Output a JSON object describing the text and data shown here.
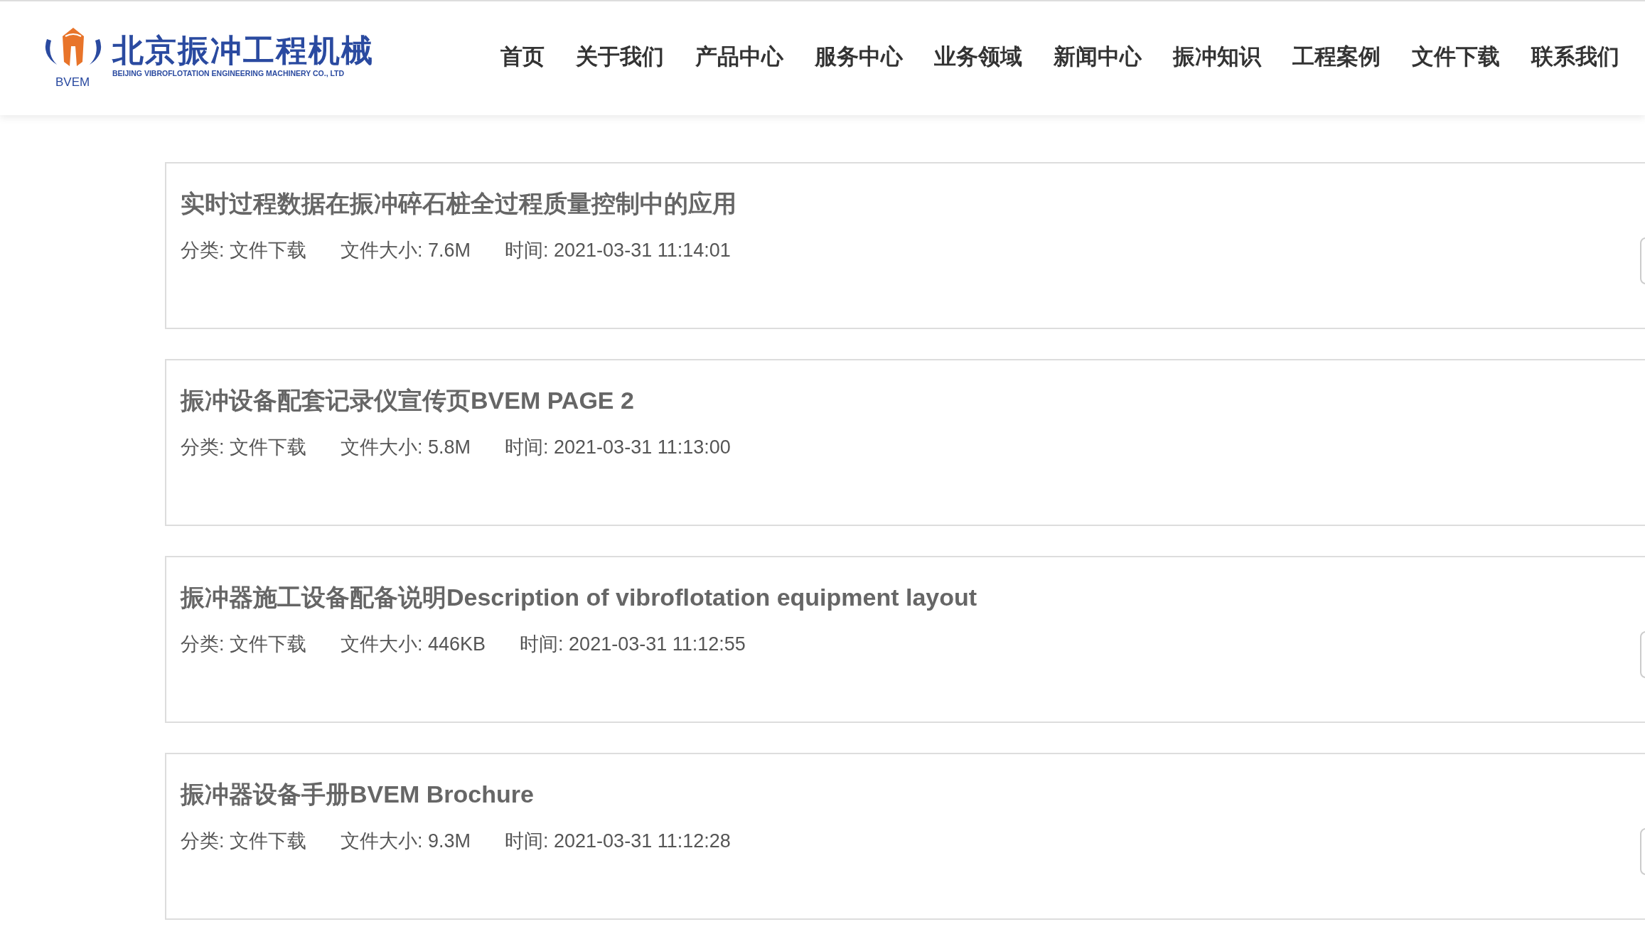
{
  "logo": {
    "badge": "BVEM",
    "name": "北京振冲工程机械",
    "english": "BEIJING VIBROFLOTATION ENGINEERING MACHINERY CO., LTD"
  },
  "nav": [
    {
      "label": "首页"
    },
    {
      "label": "关于我们"
    },
    {
      "label": "产品中心"
    },
    {
      "label": "服务中心"
    },
    {
      "label": "业务领域"
    },
    {
      "label": "新闻中心"
    },
    {
      "label": "振冲知识"
    },
    {
      "label": "工程案例"
    },
    {
      "label": "文件下载"
    },
    {
      "label": "联系我们"
    }
  ],
  "files": [
    {
      "title": "实时过程数据在振冲碎石桩全过程质量控制中的应用",
      "category": "分类: 文件下载",
      "size": "文件大小: 7.6M",
      "time": "时间: 2021-03-31 11:14:01",
      "button_visible": true
    },
    {
      "title": "振冲设备配套记录仪宣传页BVEM PAGE 2",
      "category": "分类: 文件下载",
      "size": "文件大小: 5.8M",
      "time": "时间: 2021-03-31 11:13:00",
      "button_visible": false
    },
    {
      "title": "振冲器施工设备配备说明Description of vibroflotation equipment layout",
      "category": "分类: 文件下载",
      "size": "文件大小: 446KB",
      "time": "时间: 2021-03-31 11:12:55",
      "button_visible": true
    },
    {
      "title": "振冲器设备手册BVEM Brochure",
      "category": "分类: 文件下载",
      "size": "文件大小: 9.3M",
      "time": "时间: 2021-03-31 11:12:28",
      "button_visible": true
    }
  ]
}
